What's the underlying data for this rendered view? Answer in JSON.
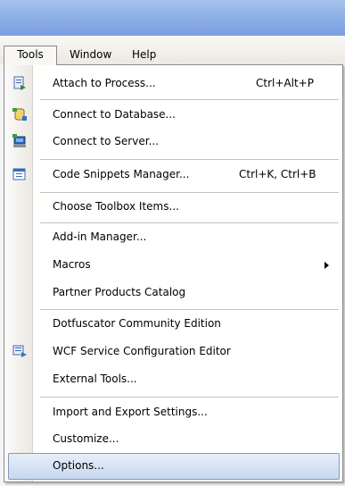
{
  "menubar": {
    "items": [
      "Tools",
      "Window",
      "Help"
    ]
  },
  "tools_menu": {
    "items": [
      {
        "label": "Attach to Process...",
        "shortcut": "Ctrl+Alt+P",
        "icon": "attach-process-icon"
      },
      {
        "label": "Connect to Database...",
        "icon": "connect-database-icon"
      },
      {
        "label": "Connect to Server...",
        "icon": "connect-server-icon"
      },
      {
        "label": "Code Snippets Manager...",
        "shortcut": "Ctrl+K, Ctrl+B",
        "icon": "snippets-manager-icon"
      },
      {
        "label": "Choose Toolbox Items..."
      },
      {
        "label": "Add-in Manager..."
      },
      {
        "label": "Macros",
        "submenu": true
      },
      {
        "label": "Partner Products Catalog"
      },
      {
        "label": "Dotfuscator Community Edition"
      },
      {
        "label": "WCF Service Configuration Editor",
        "icon": "wcf-editor-icon"
      },
      {
        "label": "External Tools..."
      },
      {
        "label": "Import and Export Settings..."
      },
      {
        "label": "Customize..."
      },
      {
        "label": "Options...",
        "selected": true
      }
    ]
  },
  "colors": {
    "titlebar": "#8fb0e6",
    "menubar": "#ece9df",
    "selection": "#c8d8f0",
    "selection_border": "#7f9db9"
  }
}
